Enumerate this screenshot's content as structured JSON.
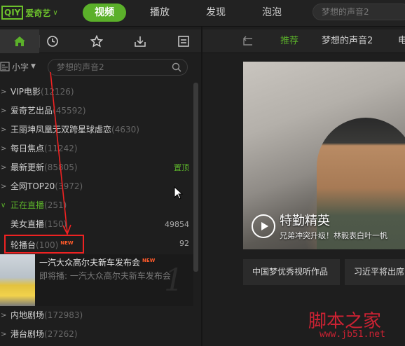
{
  "header": {
    "logo_box": "QIY",
    "logo_text": "爱奇艺",
    "tabs": [
      {
        "label": "视频"
      },
      {
        "label": "播放"
      },
      {
        "label": "发现"
      },
      {
        "label": "泡泡"
      }
    ],
    "search_placeholder": "梦想的声音2"
  },
  "sidebar": {
    "font_label": "小字",
    "search_placeholder": "梦想的声音2",
    "items": [
      {
        "label": "VIP电影",
        "count": "(12126)",
        "right": ""
      },
      {
        "label": "爱奇艺出品",
        "count": "(45592)",
        "right": ""
      },
      {
        "label": "王丽坤凤凰无双跨星球虐恋",
        "count": "(4630)",
        "right": ""
      },
      {
        "label": "每日焦点",
        "count": "(11242)",
        "right": ""
      },
      {
        "label": "最新更新",
        "count": "(85805)",
        "right": "置顶"
      },
      {
        "label": "全网TOP20",
        "count": "(3972)",
        "right": ""
      },
      {
        "label": "正在直播",
        "count": "(251)",
        "right": ""
      },
      {
        "label": "美女直播",
        "count": "(150)",
        "right": "49854"
      },
      {
        "label": "轮播台",
        "count": "(100)",
        "badge": "NEW",
        "right": "92"
      },
      {
        "label": "内地剧场",
        "count": "(172983)",
        "right": ""
      },
      {
        "label": "港台剧场",
        "count": "(27262)",
        "right": ""
      }
    ],
    "carousel": {
      "title": "一汽大众高尔夫新车发布会",
      "badge": "NEW",
      "next": "即将播: 一汽大众高尔夫新车发布会",
      "number": "1"
    }
  },
  "main": {
    "tabs": [
      {
        "label": "推荐"
      },
      {
        "label": "梦想的声音2"
      },
      {
        "label": "电"
      }
    ],
    "banner": {
      "title": "特勤精英",
      "subtitle": "兄弟冲突升级！林毅表白叶一帆"
    },
    "cards": [
      {
        "label": "中国梦优秀视听作品"
      },
      {
        "label": "习近平将出席"
      }
    ]
  },
  "watermark": {
    "text": "脚本之家",
    "url": "www.jb51.net"
  },
  "colors": {
    "accent": "#5bb02a",
    "annotation": "#e22222",
    "badge": "#ff5a2a"
  }
}
